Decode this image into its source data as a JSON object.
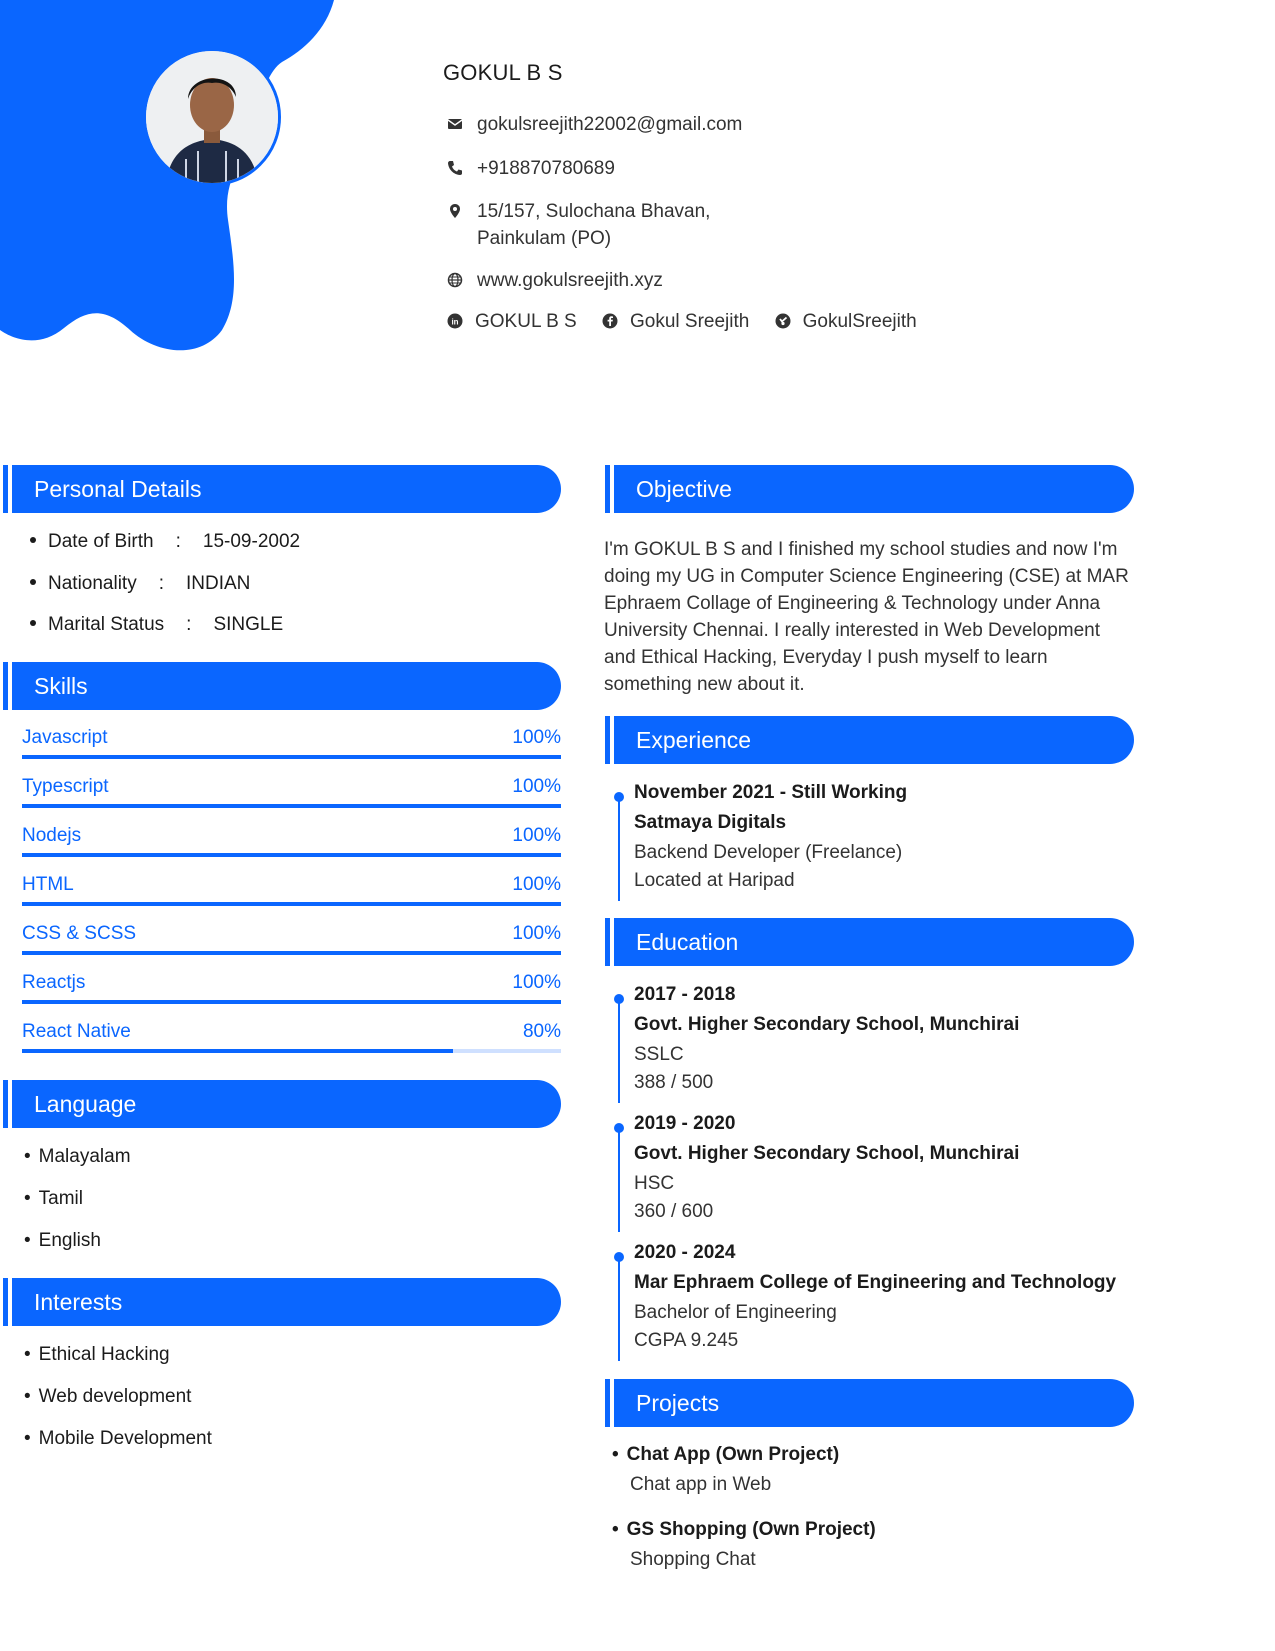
{
  "header": {
    "name": "GOKUL B S",
    "email": "gokulsreejith22002@gmail.com",
    "phone": "+918870780689",
    "address_line1": "15/157, Sulochana Bhavan,",
    "address_line2": "Painkulam (PO)",
    "website": "www.gokulsreejith.xyz",
    "social": [
      {
        "icon": "linkedin-icon",
        "label": "GOKUL B S"
      },
      {
        "icon": "facebook-icon",
        "label": "Gokul Sreejith"
      },
      {
        "icon": "github-icon",
        "label": "GokulSreejith"
      }
    ]
  },
  "colors": {
    "accent": "#0a66ff",
    "track": "#cfe0ff"
  },
  "personal_details": {
    "title": "Personal Details",
    "items": [
      {
        "label": "Date of Birth",
        "sep": ":",
        "value": "15-09-2002"
      },
      {
        "label": "Nationality",
        "sep": ":",
        "value": "INDIAN"
      },
      {
        "label": "Marital Status",
        "sep": ":",
        "value": "SINGLE"
      }
    ]
  },
  "skills": {
    "title": "Skills",
    "items": [
      {
        "name": "Javascript",
        "percent_label": "100%",
        "level": 100
      },
      {
        "name": "Typescript",
        "percent_label": "100%",
        "level": 100
      },
      {
        "name": "Nodejs",
        "percent_label": "100%",
        "level": 100
      },
      {
        "name": "HTML",
        "percent_label": "100%",
        "level": 100
      },
      {
        "name": "CSS & SCSS",
        "percent_label": "100%",
        "level": 100
      },
      {
        "name": "Reactjs",
        "percent_label": "100%",
        "level": 100
      },
      {
        "name": "React Native",
        "percent_label": "80%",
        "level": 80
      }
    ]
  },
  "language": {
    "title": "Language",
    "items": [
      "Malayalam",
      "Tamil",
      "English"
    ]
  },
  "interests": {
    "title": "Interests",
    "items": [
      "Ethical Hacking",
      "Web development",
      "Mobile Development"
    ]
  },
  "objective": {
    "title": "Objective",
    "text": "I'm GOKUL B S and I finished my school studies and now I'm doing my UG in Computer Science Engineering (CSE) at MAR Ephraem Collage of Engineering & Technology under Anna University Chennai. I really interested in Web Development and Ethical Hacking, Everyday I push myself to learn something new about it."
  },
  "experience": {
    "title": "Experience",
    "items": [
      {
        "period": "November 2021 - Still Working",
        "org": "Satmaya Digitals",
        "role": "Backend Developer (Freelance)",
        "detail": "Located at Haripad"
      }
    ]
  },
  "education": {
    "title": "Education",
    "items": [
      {
        "period": "2017 - 2018",
        "org": "Govt. Higher Secondary School, Munchirai",
        "role": "SSLC",
        "detail": "388 / 500"
      },
      {
        "period": "2019 - 2020",
        "org": "Govt. Higher Secondary School, Munchirai",
        "role": "HSC",
        "detail": "360 / 600"
      },
      {
        "period": "2020 - 2024",
        "org": "Mar Ephraem College of Engineering and Technology",
        "role": "Bachelor of Engineering",
        "detail": "CGPA 9.245"
      }
    ]
  },
  "projects": {
    "title": "Projects",
    "items": [
      {
        "name": "Chat App (Own Project)",
        "desc": "Chat app in Web"
      },
      {
        "name": "GS Shopping (Own Project)",
        "desc": "Shopping Chat"
      }
    ]
  }
}
